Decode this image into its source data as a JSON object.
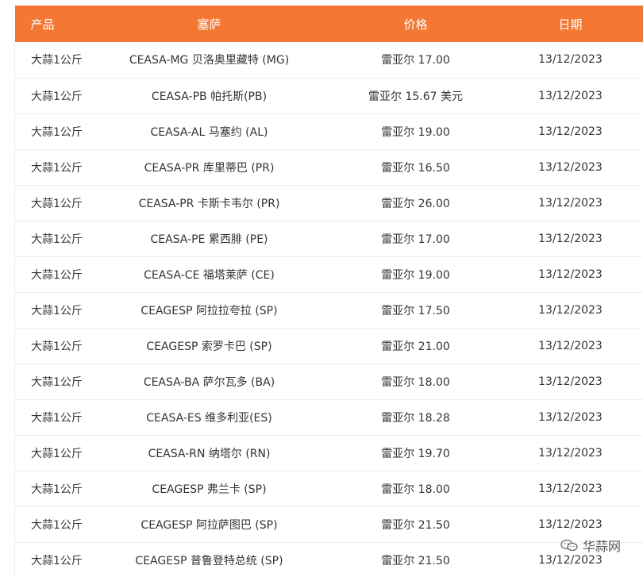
{
  "table": {
    "headers": [
      "产品",
      "塞萨",
      "价格",
      "日期"
    ],
    "rows": [
      [
        "大蒜1公斤",
        "CEASA-MG 贝洛奥里藏特 (MG)",
        "雷亚尔 17.00",
        "13/12/2023"
      ],
      [
        "大蒜1公斤",
        "CEASA-PB 帕托斯(PB)",
        "雷亚尔 15.67 美元",
        "13/12/2023"
      ],
      [
        "大蒜1公斤",
        "CEASA-AL 马塞约 (AL)",
        "雷亚尔 19.00",
        "13/12/2023"
      ],
      [
        "大蒜1公斤",
        "CEASA-PR 库里蒂巴 (PR)",
        "雷亚尔 16.50",
        "13/12/2023"
      ],
      [
        "大蒜1公斤",
        "CEASA-PR 卡斯卡韦尔 (PR)",
        "雷亚尔 26.00",
        "13/12/2023"
      ],
      [
        "大蒜1公斤",
        "CEASA-PE 累西腓 (PE)",
        "雷亚尔 17.00",
        "13/12/2023"
      ],
      [
        "大蒜1公斤",
        "CEASA-CE 福塔莱萨 (CE)",
        "雷亚尔 19.00",
        "13/12/2023"
      ],
      [
        "大蒜1公斤",
        "CEAGESP 阿拉拉夸拉 (SP)",
        "雷亚尔 17.50",
        "13/12/2023"
      ],
      [
        "大蒜1公斤",
        "CEAGESP 索罗卡巴 (SP)",
        "雷亚尔 21.00",
        "13/12/2023"
      ],
      [
        "大蒜1公斤",
        "CEASA-BA 萨尔瓦多 (BA)",
        "雷亚尔 18.00",
        "13/12/2023"
      ],
      [
        "大蒜1公斤",
        "CEASA-ES 维多利亚(ES)",
        "雷亚尔 18.28",
        "13/12/2023"
      ],
      [
        "大蒜1公斤",
        "CEASA-RN 纳塔尔 (RN)",
        "雷亚尔 19.70",
        "13/12/2023"
      ],
      [
        "大蒜1公斤",
        "CEAGESP 弗兰卡 (SP)",
        "雷亚尔 18.00",
        "13/12/2023"
      ],
      [
        "大蒜1公斤",
        "CEAGESP 阿拉萨图巴 (SP)",
        "雷亚尔 21.50",
        "13/12/2023"
      ],
      [
        "大蒜1公斤",
        "CEAGESP 普鲁登特总统 (SP)",
        "雷亚尔 21.50",
        "13/12/2023"
      ]
    ]
  },
  "watermark": {
    "text": "华蒜网",
    "icon": "wechat-icon"
  },
  "colors": {
    "header_bg": "#f47733",
    "header_text": "#ffffff",
    "row_divider": "#ececec"
  }
}
